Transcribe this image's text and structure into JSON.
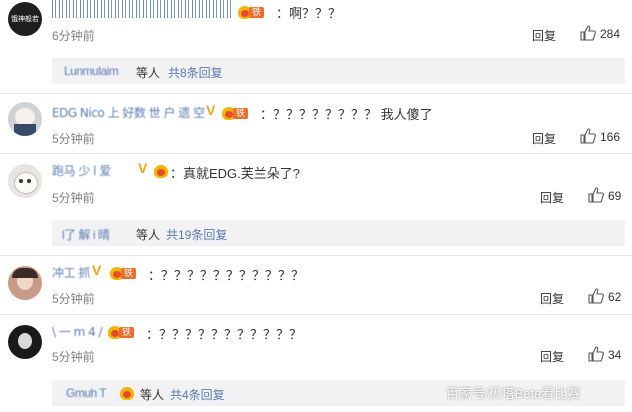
{
  "comments": [
    {
      "avatar_text": "饿神般若",
      "username": "",
      "badge": "铁粉",
      "text": "：啊？？？",
      "time": "6分钟前",
      "reply": "回复",
      "likes": "284"
    },
    {
      "avatar_text": "",
      "username": "EDG Nico 上 好数 世 户 遗 空",
      "badge": "铁粉",
      "text": "：？？？？？？？？ 我人傻了",
      "time": "5分钟前",
      "reply": "回复",
      "likes": "166"
    },
    {
      "avatar_text": "",
      "username": "跑马 少 l 爱",
      "badge": "铁粉",
      "text": "：真就EDG.芙兰朵了?",
      "time": "5分钟前",
      "reply": "回复",
      "likes": "69"
    },
    {
      "avatar_text": "",
      "username": "冲工 抓",
      "badge": "铁粉",
      "text": "：？？？？？？？？？？？",
      "time": "5分钟前",
      "reply": "回复",
      "likes": "62"
    },
    {
      "avatar_text": "",
      "username": "\\ 一 m 4 /",
      "badge": "铁粉",
      "text": "：？？？？？？？？？？？",
      "time": "5分钟前",
      "reply": "回复",
      "likes": "34"
    }
  ],
  "reply_boxes": [
    {
      "name": "Lunmulaim",
      "suffix": "等人",
      "count_text": "共8条回复"
    },
    {
      "name": "l了 解 i 晴",
      "suffix": "等人",
      "count_text": "共19条回复"
    },
    {
      "name": "Gmuh T",
      "suffix": "等人",
      "count_text": "共4条回复"
    }
  ],
  "watermark": "百家号/贝塔Beta看比赛",
  "colors": {
    "link": "#5b7bb2",
    "badge": "#ef6d2c",
    "vip": "#f0a21a",
    "reply_bg": "#f2f2f5"
  }
}
